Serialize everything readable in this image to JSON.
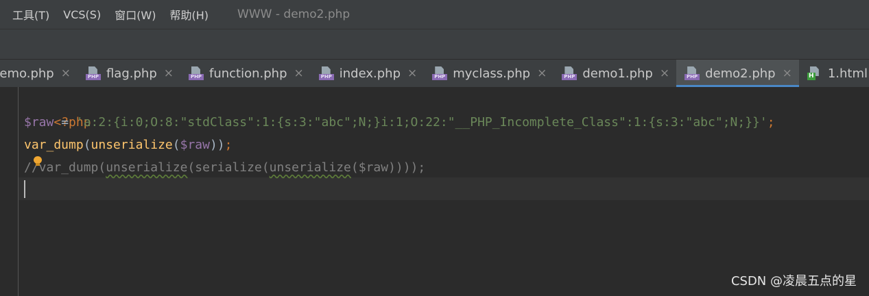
{
  "menu": {
    "items": [
      {
        "label": "工具(T)"
      },
      {
        "label": "VCS(S)"
      },
      {
        "label": "窗口(W)"
      },
      {
        "label": "帮助(H)"
      }
    ],
    "window_title": "WWW - demo2.php"
  },
  "tabs": [
    {
      "label": "demo.php",
      "icon": "php-file-icon",
      "close": "×"
    },
    {
      "label": "flag.php",
      "icon": "php-file-icon",
      "close": "×"
    },
    {
      "label": "function.php",
      "icon": "php-file-icon",
      "close": "×"
    },
    {
      "label": "index.php",
      "icon": "php-file-icon",
      "close": "×"
    },
    {
      "label": "myclass.php",
      "icon": "php-file-icon",
      "close": "×"
    },
    {
      "label": "demo1.php",
      "icon": "php-file-icon",
      "close": "×"
    },
    {
      "label": "demo2.php",
      "icon": "php-file-icon",
      "close": "×",
      "active": true
    },
    {
      "label": "1.html",
      "icon": "html-file-icon"
    }
  ],
  "file_icon_tags": {
    "php": "PHP",
    "html": "H"
  },
  "code": {
    "line1": {
      "open_tag": "<?php"
    },
    "line2": {
      "var": "$raw",
      "op": " = ",
      "string": "'a:2:{i:0;O:8:\"stdClass\":1:{s:3:\"abc\";N;}i:1;O:22:\"__PHP_Incomplete_Class\":1:{s:3:\"abc\";N;}}'",
      "semi": ";"
    },
    "line3": {
      "fn1": "var_dump",
      "p1": "(",
      "fn2": "unserialize",
      "p2": "(",
      "var": "$raw",
      "close": "))",
      "semi": ";"
    },
    "line4": {
      "prefix": "//var_dump(",
      "u1": "unserialize",
      "mid1": "(",
      "s1": "serialize",
      "mid2": "(",
      "u2": "unserialize",
      "rest": "($raw))));"
    }
  },
  "colors": {
    "keyword": "#cc7832",
    "variable": "#9876aa",
    "string": "#6a8759",
    "function": "#ffc66d",
    "comment": "#808080",
    "active_tab_underline": "#4a88c7"
  },
  "watermark": "CSDN @凌晨五点的星"
}
